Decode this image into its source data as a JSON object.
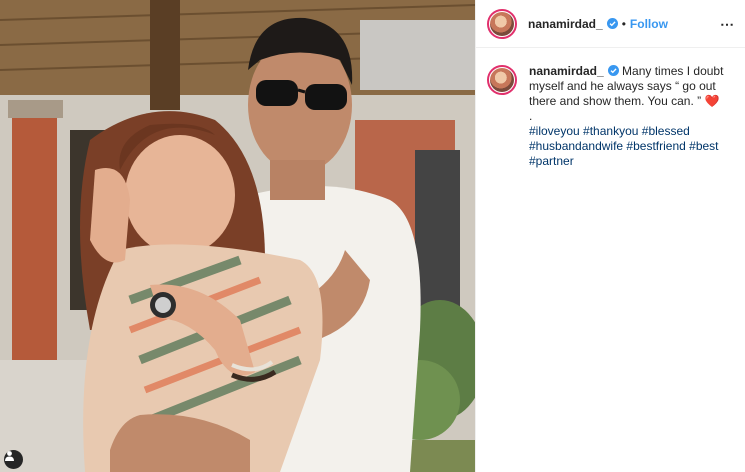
{
  "post": {
    "username": "nanamirdad_",
    "follow_label": "Follow",
    "separator": "•",
    "more_icon": "⋯",
    "caption_text": "Many times I doubt myself and he always says “ go out there and show them. You can. ”",
    "caption_emoji": "❤️",
    "caption_dot": ".",
    "hashtags": [
      "#iloveyou",
      "#thankyou",
      "#blessed",
      "#husbandandwife",
      "#bestfriend",
      "#best",
      "#partner"
    ]
  },
  "icons": {
    "verified": "verified-badge-icon",
    "more": "more-options-icon",
    "tagged_people": "user-tag-icon"
  },
  "colors": {
    "follow": "#3897f0",
    "hashtag": "#003569",
    "verified": "#3897f0",
    "heart": "#e0245e"
  }
}
